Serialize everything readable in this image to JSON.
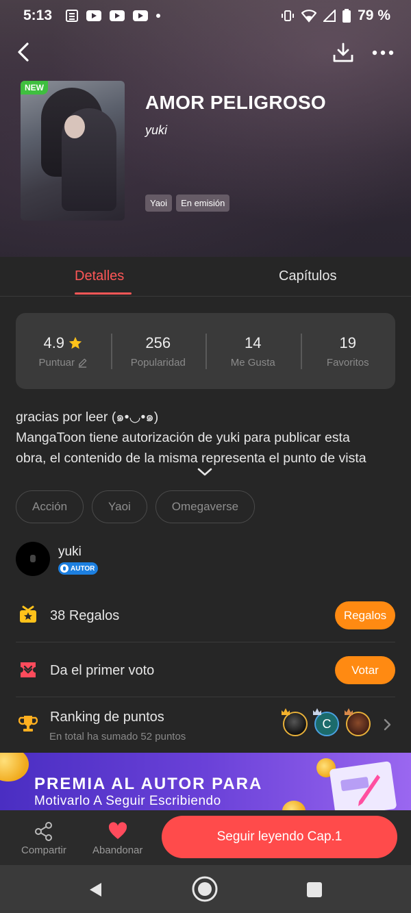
{
  "status_bar": {
    "time": "5:13",
    "battery": "79 %"
  },
  "header": {
    "badge": "NEW",
    "title": "AMOR PELIGROSO",
    "author": "yuki",
    "tags": [
      "Yaoi",
      "En emisión"
    ]
  },
  "tabs": {
    "details": "Detalles",
    "chapters": "Capítulos"
  },
  "stats": [
    {
      "value": "4.9",
      "label": "Puntuar"
    },
    {
      "value": "256",
      "label": "Popularidad"
    },
    {
      "value": "14",
      "label": "Me Gusta"
    },
    {
      "value": "19",
      "label": "Favoritos"
    }
  ],
  "description": {
    "line1": "gracias por leer (๑•◡•๑)",
    "line2": "MangaToon tiene autorización de yuki para publicar esta",
    "line3": "obra, el contenido de la misma representa el punto de vista"
  },
  "genres": [
    "Acción",
    "Yaoi",
    "Omegaverse"
  ],
  "author": {
    "name": "yuki",
    "badge": "AUTOR"
  },
  "gifts": {
    "count": "38",
    "label": "Regalos",
    "button": "Regalos"
  },
  "vote": {
    "text": "Da el primer voto",
    "button": "Votar"
  },
  "ranking": {
    "title": "Ranking de puntos",
    "subtitle": "En total ha sumado 52 puntos",
    "avatar_letter": "C"
  },
  "banner": {
    "title": "PREMIA AL AUTOR PARA",
    "subtitle": "Motivarlo A Seguir Escribiendo"
  },
  "actions": {
    "share": "Compartir",
    "abandon": "Abandonar",
    "read": "Seguir leyendo Cap.1"
  },
  "colors": {
    "accent": "#ff5757",
    "orange": "#ff8a12",
    "read_button": "#ff4b4b"
  }
}
